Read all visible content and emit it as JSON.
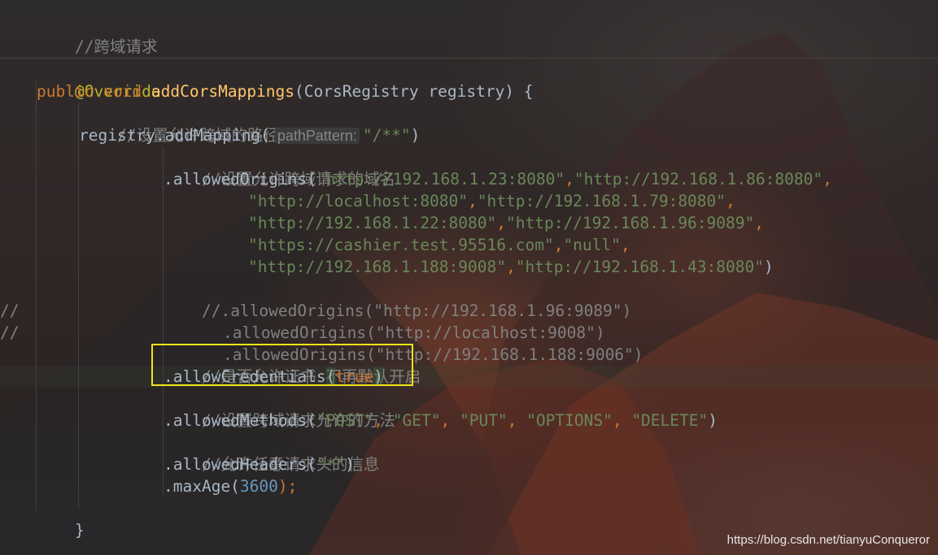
{
  "editor": {
    "lines": {
      "l1": "//跨域请求",
      "l2": "@Override",
      "l3_kw1": "public",
      "l3_kw2": "void",
      "l3_method": "addCorsMappings",
      "l3_rest": "(CorsRegistry registry) {",
      "l4": "//设置允许跨域的路径",
      "l5_pre": "registry.addMapping(",
      "l5_hint": "pathPattern:",
      "l5_str": "\"/**\"",
      "l5_post": ")",
      "l6": "//设置允许跨域请求的域名",
      "l7_pre": ".allowedOrigins(",
      "l7_s1": "\"http://192.168.1.23:8080\"",
      "l7_c1": ",",
      "l7_s2": "\"http://192.168.1.86:8080\"",
      "l7_c2": ",",
      "l8_s1": "\"http://localhost:8080\"",
      "l8_c1": ",",
      "l8_s2": "\"http://192.168.1.79:8080\"",
      "l8_c2": ",",
      "l9_s1": "\"http://192.168.1.22:8080\"",
      "l9_c1": ",",
      "l9_s2": "\"http://192.168.1.96:9089\"",
      "l9_c2": ",",
      "l10_s1": "\"https://cashier.test.95516.com\"",
      "l10_c1": ",",
      "l10_s2": "\"null\"",
      "l10_c2": ",",
      "l11_s1": "\"http://192.168.1.188:9008\"",
      "l11_c1": ",",
      "l11_s2": "\"http://192.168.1.43:8080\"",
      "l11_end": ")",
      "l12": "//.allowedOrigins(\"http://192.168.1.96:9089\")",
      "l13": ".allowedOrigins(\"http://localhost:9008\")",
      "l14": ".allowedOrigins(\"http://192.168.1.188:9006\")",
      "l15": "//是否允许证书 不再默认开启",
      "l16_pre": ".allowCredentials",
      "l16_p1": "(",
      "l16_kw": "true",
      "l16_p2": ")",
      "l17": "//设置跨域请求允许的方法",
      "l18_pre": ".allowedMethods(",
      "l18_s1": "\"POST\"",
      "l18_c1": ", ",
      "l18_s2": "\"GET\"",
      "l18_c2": ", ",
      "l18_s3": "\"PUT\"",
      "l18_c3": ", ",
      "l18_s4": "\"OPTIONS\"",
      "l18_c4": ", ",
      "l18_s5": "\"DELETE\"",
      "l18_end": ")",
      "l19": "//允许任意请求头的信息",
      "l20_pre": ".allowedHeaders(",
      "l20_s": "\"*\"",
      "l20_end": ")",
      "l21_pre": ".maxAge(",
      "l21_num": "3600",
      "l21_end": ");",
      "l22": "}"
    },
    "gutter_marks": [
      "//",
      "//"
    ]
  },
  "watermark": "https://blog.csdn.net/tianyuConqueror",
  "colors": {
    "comment": "#808080",
    "annotation": "#bbb529",
    "keyword": "#cc7832",
    "method": "#ffc66d",
    "string": "#6a8759",
    "number": "#6897bb",
    "text": "#a9b7c6",
    "highlight_box": "#f2e21b"
  }
}
